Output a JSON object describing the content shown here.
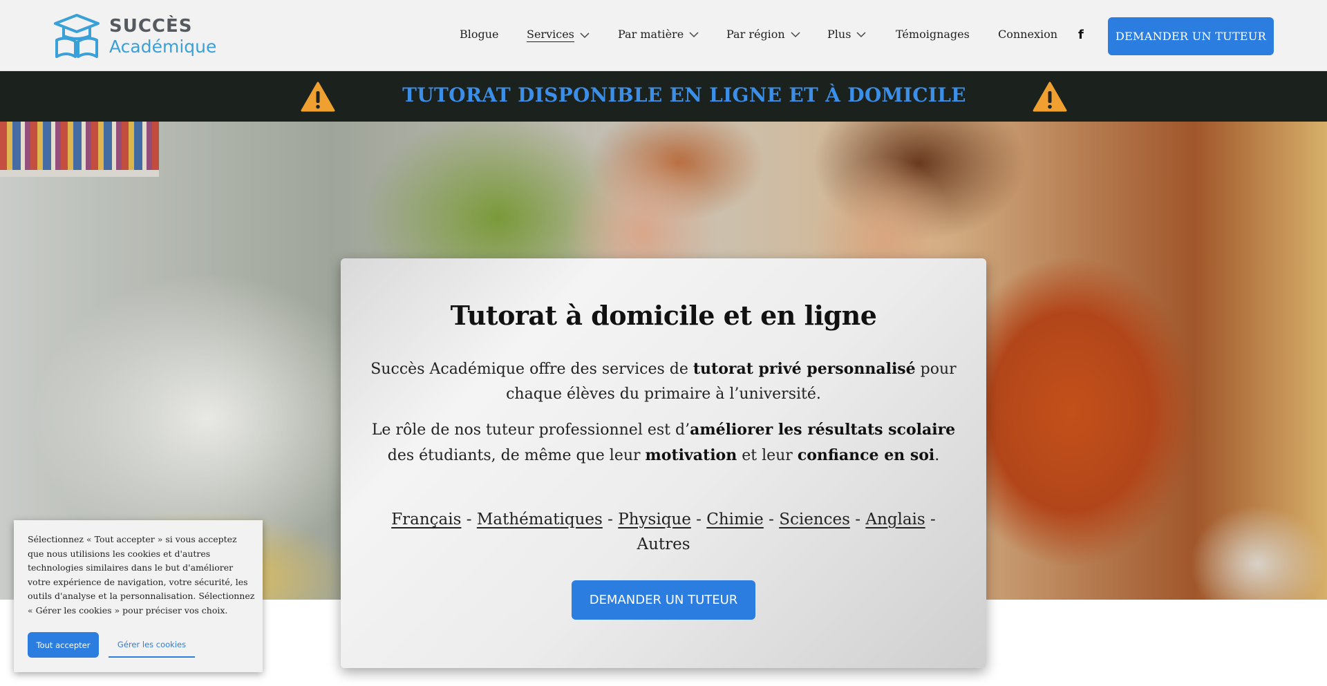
{
  "logo": {
    "line1": "SUCCÈS",
    "line2": "Académique",
    "icon": "graduation-cap-book-icon"
  },
  "nav": {
    "items": [
      {
        "label": "Blogue",
        "dropdown": false
      },
      {
        "label": "Services",
        "dropdown": true,
        "active": true
      },
      {
        "label": "Par matière",
        "dropdown": true
      },
      {
        "label": "Par région",
        "dropdown": true
      },
      {
        "label": "Plus",
        "dropdown": true
      },
      {
        "label": "Témoignages",
        "dropdown": false
      },
      {
        "label": "Connexion",
        "dropdown": false
      }
    ],
    "social_icon": "facebook-icon",
    "social_glyph": "f",
    "cta_label": "DEMANDER UN TUTEUR"
  },
  "banner": {
    "text": "TUTORAT DISPONIBLE EN LIGNE ET À DOMICILE",
    "icon": "warning-icon"
  },
  "card": {
    "title": "Tutorat à domicile et en ligne",
    "p1": {
      "a": "Succès Académique offre des services de ",
      "b": "tutorat privé personnalisé",
      "c": " pour chaque élèves du primaire à l’université."
    },
    "p2": {
      "a": "Le rôle de nos tuteur professionnel est d’",
      "b": "améliorer les résultats scolaire",
      "c": " des étudiants, de même que leur ",
      "d": "motivation",
      "e": " et leur ",
      "f": "confiance en soi",
      "g": "."
    },
    "subjects": [
      "Français",
      "Mathématiques",
      "Physique",
      "Chimie",
      "Sciences",
      "Anglais"
    ],
    "subjects_sep": " - ",
    "subjects_last": "Autres",
    "cta_label": "DEMANDER UN TUTEUR"
  },
  "cookie": {
    "text": "Sélectionnez « Tout accepter » si vous acceptez que nous utilisions les cookies et d'autres technologies similaires dans le but d'améliorer votre expérience de navigation, votre sécurité, les outils d'analyse et la personnalisation. Sélectionnez « Gérer les cookies » pour préciser vos choix.",
    "accept_label": "Tout accepter",
    "manage_label": "Gérer les cookies"
  },
  "colors": {
    "accent": "#2b7de0",
    "banner_bg": "#1b211d",
    "banner_text": "#3c8fe8",
    "logo_blue": "#3aa0d8",
    "warning": "#f0a030"
  }
}
